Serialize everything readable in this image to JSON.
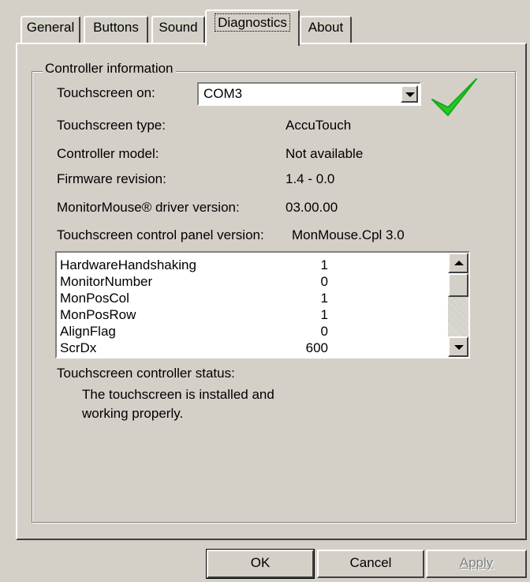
{
  "tabs": [
    {
      "label": "General",
      "active": false
    },
    {
      "label": "Buttons",
      "active": false
    },
    {
      "label": "Sound",
      "active": false
    },
    {
      "label": "Diagnostics",
      "active": true
    },
    {
      "label": "About",
      "active": false
    }
  ],
  "group": {
    "title": "Controller information"
  },
  "touchscreen_on": {
    "label": "Touchscreen on:",
    "selected": "COM3"
  },
  "status_icon": "checkmark-icon",
  "info_rows": [
    {
      "label": "Touchscreen type:",
      "value": "AccuTouch"
    },
    {
      "label": "Controller model:",
      "value": "Not available"
    },
    {
      "label": "Firmware revision:",
      "value": "1.4 - 0.0"
    },
    {
      "label": "MonitorMouse® driver version:",
      "value": "03.00.00"
    },
    {
      "label": "Touchscreen control panel version:",
      "value": "MonMouse.Cpl 3.0"
    }
  ],
  "registry_list": [
    {
      "key": "HardwareHandshaking",
      "value": "1"
    },
    {
      "key": "MonitorNumber",
      "value": "0"
    },
    {
      "key": "MonPosCol",
      "value": "1"
    },
    {
      "key": "MonPosRow",
      "value": "1"
    },
    {
      "key": "AlignFlag",
      "value": "0"
    },
    {
      "key": "ScrDx",
      "value": "600"
    }
  ],
  "controller_status": {
    "label": "Touchscreen controller status:",
    "text": "The touchscreen is installed and working properly."
  },
  "buttons": {
    "ok": "OK",
    "cancel": "Cancel",
    "apply": "Apply"
  },
  "colors": {
    "face": "#d4d0c8",
    "check": "#22cc22"
  }
}
